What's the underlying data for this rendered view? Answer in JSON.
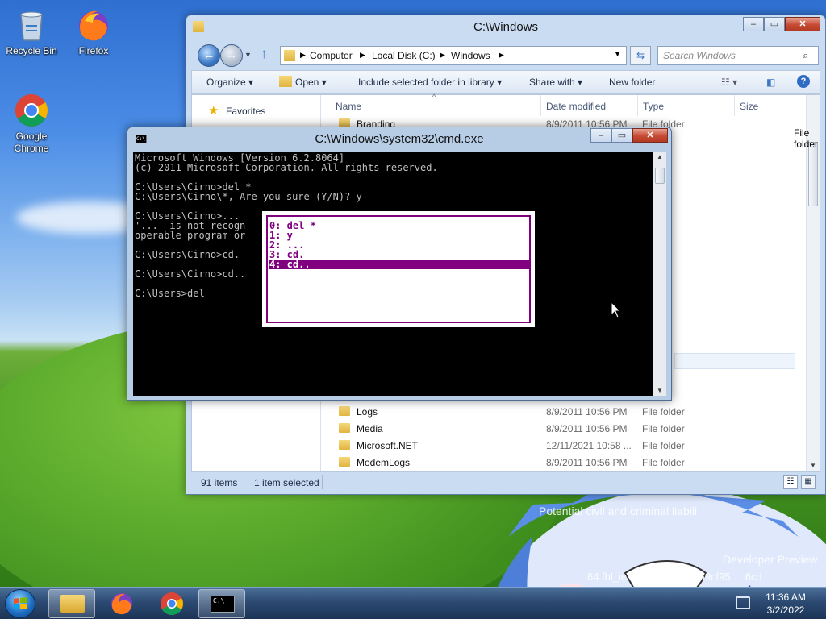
{
  "desktop": {
    "icons": [
      {
        "label": "Recycle Bin",
        "icon": "recycle-bin-icon"
      },
      {
        "label": "Firefox",
        "icon": "firefox-icon"
      },
      {
        "label": "Google Chrome",
        "icon": "chrome-icon"
      }
    ],
    "overlay": {
      "line1": "Potential civil and criminal liabili",
      "line2": "Developer Preview",
      "line3": "64.fbl_ieap.11080 ... 0.959cf95 ... 6cd"
    }
  },
  "explorer": {
    "title": "C:\\Windows",
    "breadcrumb": [
      "Computer",
      "Local Disk (C:)",
      "Windows"
    ],
    "search_placeholder": "Search Windows",
    "toolbar": {
      "organize": "Organize",
      "open": "Open",
      "include": "Include selected folder in library",
      "share": "Share with",
      "new_folder": "New folder"
    },
    "nav": {
      "favorites": "Favorites"
    },
    "columns": {
      "name": "Name",
      "date": "Date modified",
      "type": "Type",
      "size": "Size"
    },
    "rows": [
      {
        "name": "Branding",
        "date": "8/9/2011 10:56 PM",
        "type": "File folder"
      },
      {
        "name": "Logs",
        "date": "8/9/2011 10:56 PM",
        "type": "File folder"
      },
      {
        "name": "Media",
        "date": "8/9/2011 10:56 PM",
        "type": "File folder"
      },
      {
        "name": "Microsoft.NET",
        "date": "12/11/2021 10:58 ...",
        "type": "File folder"
      },
      {
        "name": "ModemLogs",
        "date": "8/9/2011 10:56 PM",
        "type": "File folder"
      }
    ],
    "hidden_type_label": "File folder",
    "status": {
      "items": "91 items",
      "selected": "1 item selected"
    }
  },
  "cmd": {
    "title": "C:\\Windows\\system32\\cmd.exe",
    "lines": [
      "Microsoft Windows [Version 6.2.8064]",
      "(c) 2011 Microsoft Corporation. All rights reserved.",
      "",
      "C:\\Users\\Cirno>del *",
      "C:\\Users\\Cirno\\*, Are you sure (Y/N)? y",
      "",
      "C:\\Users\\Cirno>...",
      "'...' is not recogn",
      "operable program or",
      "",
      "C:\\Users\\Cirno>cd.",
      "",
      "C:\\Users\\Cirno>cd..",
      "",
      "C:\\Users>del"
    ],
    "history": [
      "0: del *",
      "1: y",
      "2: ...",
      "3: cd.",
      "4: cd.."
    ],
    "selected_history": 4,
    "history_color": "#800080"
  },
  "taskbar": {
    "time": "11:36 AM",
    "date": "3/2/2022"
  }
}
